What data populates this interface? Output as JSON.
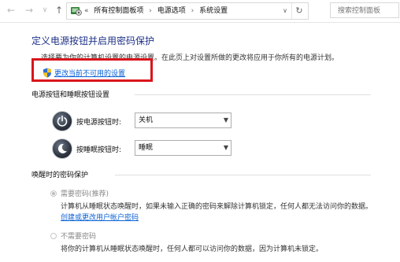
{
  "address_bar": {
    "back": "←",
    "forward": "→",
    "up": "↑",
    "overflow": "«",
    "path": [
      "所有控制面板项",
      "电源选项",
      "系统设置"
    ],
    "separator": "›",
    "dropdown": "∨",
    "refresh": "↻",
    "search_placeholder": "搜索控制面板"
  },
  "page": {
    "title": "定义电源按钮并启用密码保护",
    "description": "选择要为你的计算机设置的电源设置。在此页上对设置所做的更改将应用于你所有的电源计划。",
    "change_link": "更改当前不可用的设置"
  },
  "power_buttons": {
    "section_title": "电源按钮和睡眠按钮设置",
    "rows": [
      {
        "label": "按电源按钮时:",
        "value": "关机",
        "icon": "power-icon"
      },
      {
        "label": "按睡眠按钮时:",
        "value": "睡眠",
        "icon": "sleep-icon"
      }
    ]
  },
  "password": {
    "section_title": "唤醒时的密码保护",
    "options": [
      {
        "label": "需要密码(推荐)",
        "selected": true,
        "body": "计算机从睡眠状态唤醒时，如果未输入正确的密码来解除计算机锁定，任何人都无法访问你的数据。",
        "link": "创建或更改用户帐户密码"
      },
      {
        "label": "不需要密码",
        "selected": false,
        "body": "将你的计算机从睡眠状态唤醒时，任何人都可以访问你的数据，因为计算机未锁定。"
      }
    ]
  },
  "colors": {
    "title": "#1e3287",
    "link": "#0b62d6",
    "highlight_border": "#d9151b"
  }
}
